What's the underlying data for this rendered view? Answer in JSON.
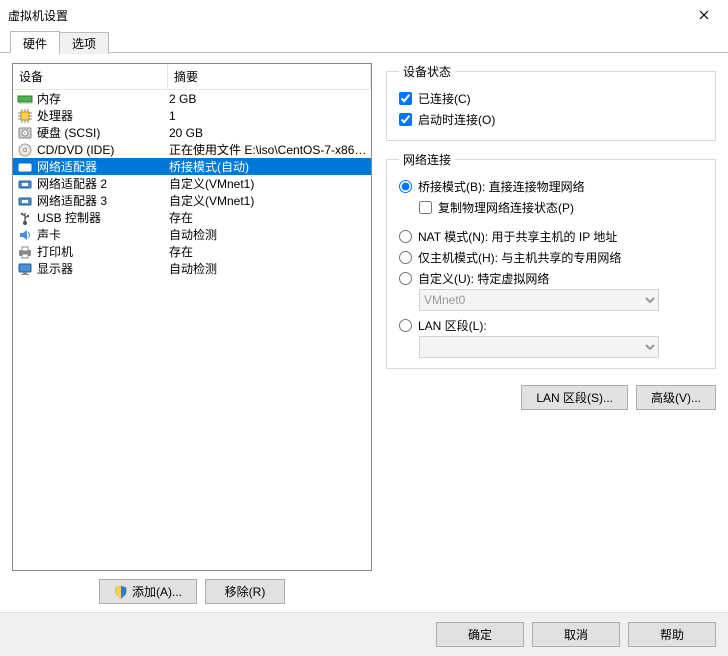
{
  "window": {
    "title": "虚拟机设置"
  },
  "tabs": {
    "hardware": "硬件",
    "options": "选项"
  },
  "columns": {
    "device": "设备",
    "summary": "摘要"
  },
  "devices": [
    {
      "icon": "memory",
      "name": "内存",
      "summary": "2 GB"
    },
    {
      "icon": "cpu",
      "name": "处理器",
      "summary": "1"
    },
    {
      "icon": "hdd",
      "name": "硬盘 (SCSI)",
      "summary": "20 GB"
    },
    {
      "icon": "cd",
      "name": "CD/DVD (IDE)",
      "summary": "正在使用文件 E:\\iso\\CentOS-7-x86_..."
    },
    {
      "icon": "net",
      "name": "网络适配器",
      "summary": "桥接模式(自动)",
      "selected": true
    },
    {
      "icon": "net",
      "name": "网络适配器 2",
      "summary": "自定义(VMnet1)"
    },
    {
      "icon": "net",
      "name": "网络适配器 3",
      "summary": "自定义(VMnet1)"
    },
    {
      "icon": "usb",
      "name": "USB 控制器",
      "summary": "存在"
    },
    {
      "icon": "sound",
      "name": "声卡",
      "summary": "自动检测"
    },
    {
      "icon": "printer",
      "name": "打印机",
      "summary": "存在"
    },
    {
      "icon": "display",
      "name": "显示器",
      "summary": "自动检测"
    }
  ],
  "buttons": {
    "add": "添加(A)...",
    "remove": "移除(R)",
    "lan": "LAN 区段(S)...",
    "advanced": "高级(V)...",
    "ok": "确定",
    "cancel": "取消",
    "help": "帮助"
  },
  "device_status": {
    "legend": "设备状态",
    "connected": "已连接(C)",
    "connect_at_power": "启动时连接(O)"
  },
  "net_conn": {
    "legend": "网络连接",
    "bridged": "桥接模式(B): 直接连接物理网络",
    "replicate": "复制物理网络连接状态(P)",
    "nat": "NAT 模式(N): 用于共享主机的 IP 地址",
    "hostonly": "仅主机模式(H): 与主机共享的专用网络",
    "custom": "自定义(U): 特定虚拟网络",
    "custom_value": "VMnet0",
    "lanseg": "LAN 区段(L):",
    "lanseg_value": ""
  }
}
